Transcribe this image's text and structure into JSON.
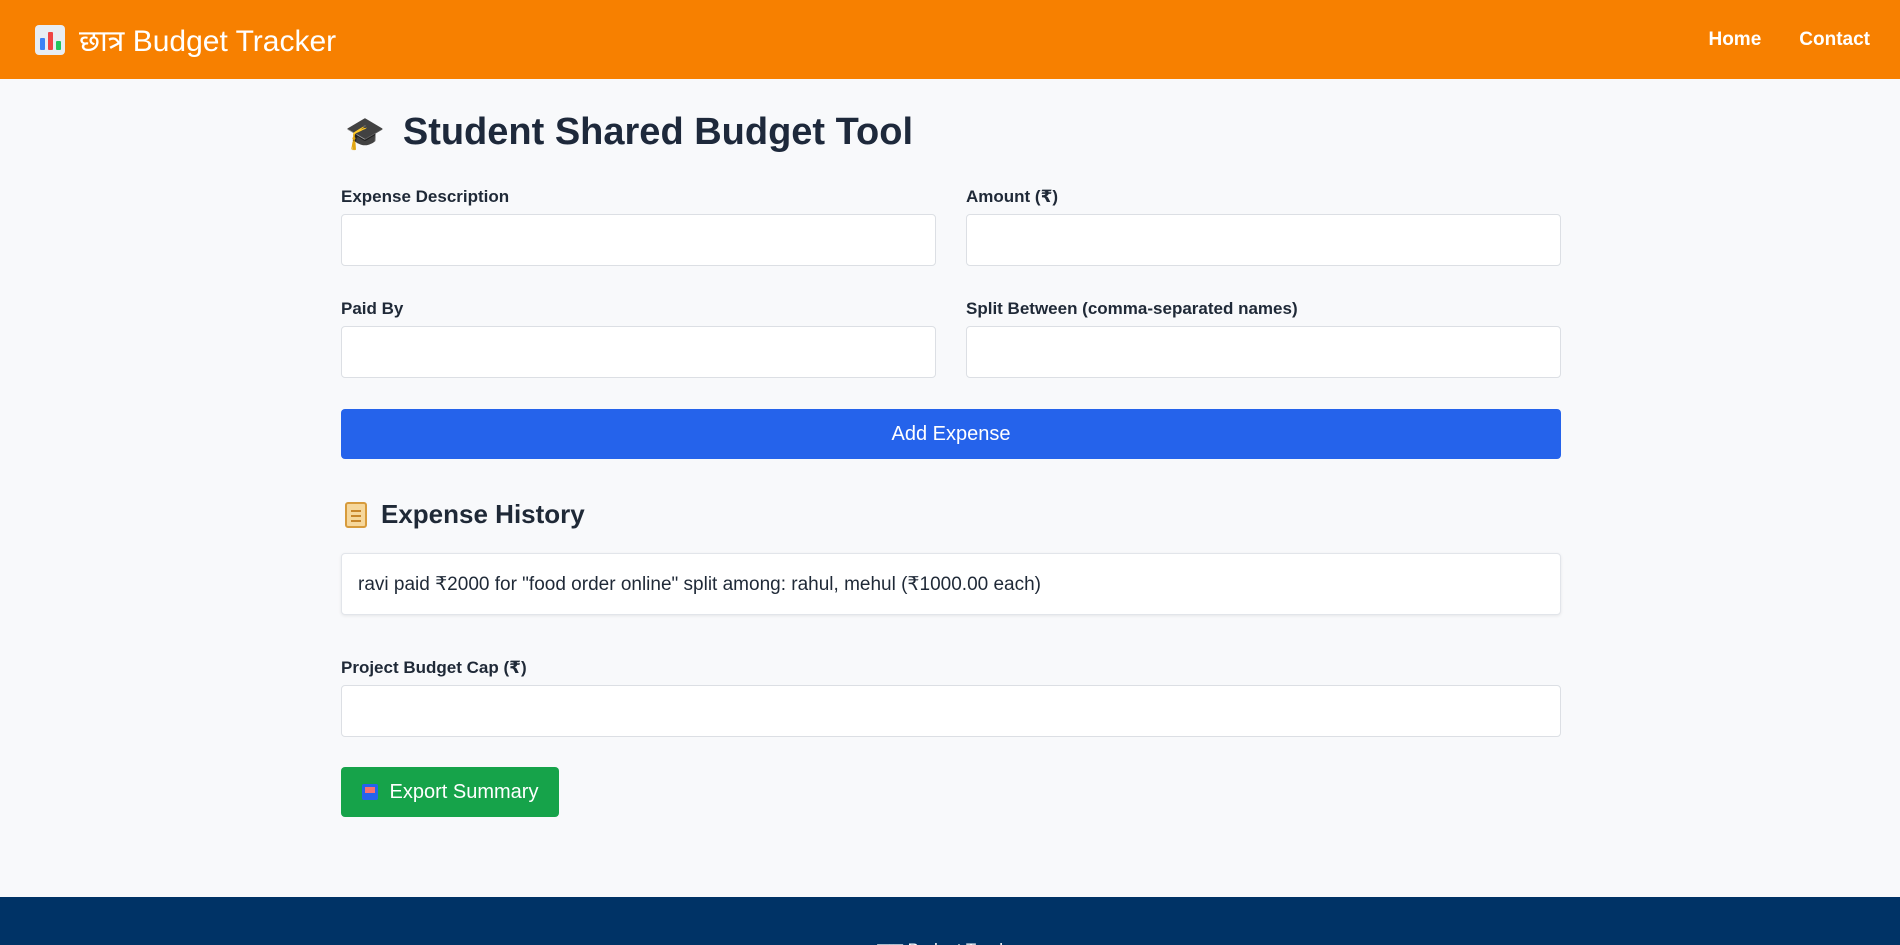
{
  "navbar": {
    "brand": "छात्र Budget Tracker",
    "links": [
      "Home",
      "Contact"
    ],
    "background": "#f78000"
  },
  "page": {
    "title": "Student Shared Budget Tool",
    "title_icon": "graduation-cap-icon"
  },
  "form": {
    "description_label": "Expense Description",
    "description_value": "",
    "amount_label": "Amount (₹)",
    "amount_value": "",
    "paid_by_label": "Paid By",
    "paid_by_value": "",
    "split_label": "Split Between (comma-separated names)",
    "split_value": "",
    "add_button": "Add Expense"
  },
  "history": {
    "title": "Expense History",
    "items": [
      "ravi paid ₹2000 for \"food order online\" split among: rahul, mehul (₹1000.00 each)"
    ]
  },
  "budget": {
    "label": "Project Budget Cap (₹)",
    "value": ""
  },
  "export_button": "Export Summary",
  "footer": {
    "text": "छात्र Budget Tracker"
  },
  "colors": {
    "primary": "#2563eb",
    "success": "#16a34a",
    "footer_bg": "#003366"
  }
}
